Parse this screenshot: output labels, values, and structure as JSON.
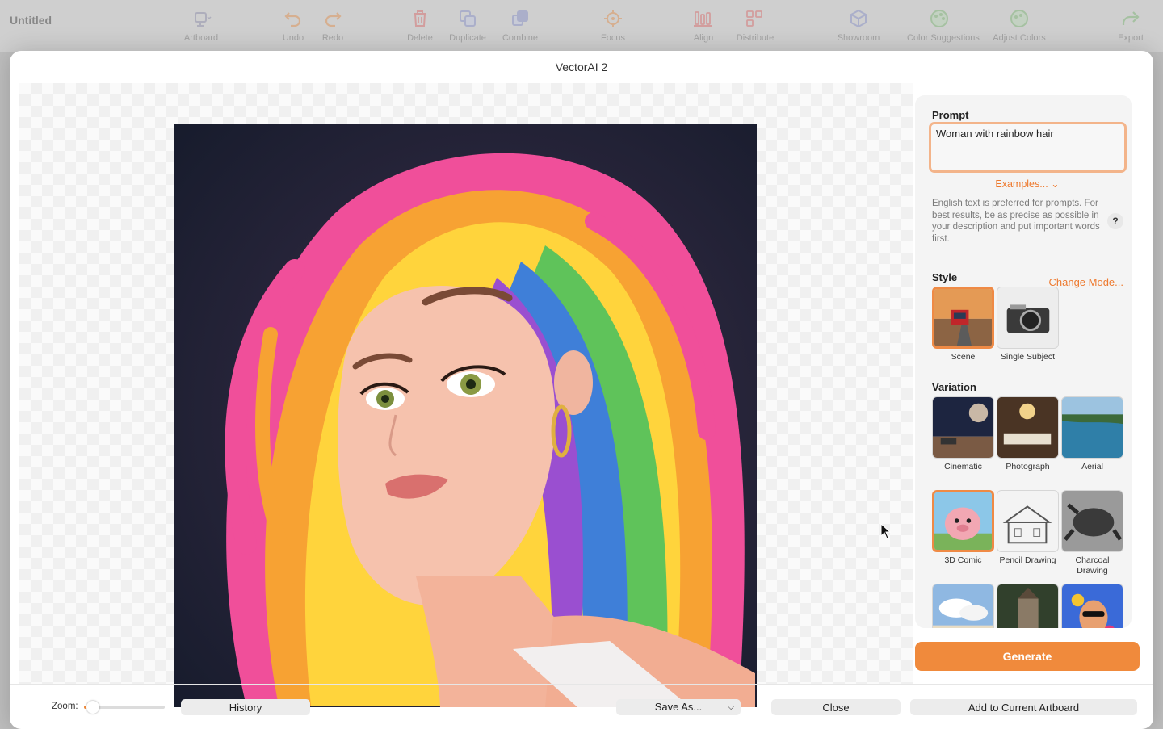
{
  "app": {
    "title": "Untitled",
    "toolbar": [
      {
        "id": "artboard",
        "label": "Artboard",
        "icon": "artboard-icon"
      },
      {
        "id": "undo",
        "label": "Undo",
        "icon": "undo-icon"
      },
      {
        "id": "redo",
        "label": "Redo",
        "icon": "redo-icon"
      },
      {
        "id": "delete",
        "label": "Delete",
        "icon": "trash-icon"
      },
      {
        "id": "duplicate",
        "label": "Duplicate",
        "icon": "duplicate-icon"
      },
      {
        "id": "combine",
        "label": "Combine",
        "icon": "combine-icon"
      },
      {
        "id": "focus",
        "label": "Focus",
        "icon": "focus-icon"
      },
      {
        "id": "align",
        "label": "Align",
        "icon": "align-icon"
      },
      {
        "id": "distribute",
        "label": "Distribute",
        "icon": "distribute-icon"
      },
      {
        "id": "showroom",
        "label": "Showroom",
        "icon": "cube-icon"
      },
      {
        "id": "color_suggestions",
        "label": "Color Suggestions",
        "icon": "palette-icon"
      },
      {
        "id": "adjust_colors",
        "label": "Adjust Colors",
        "icon": "palette-adjust-icon"
      },
      {
        "id": "export",
        "label": "Export",
        "icon": "share-arrow-icon"
      }
    ]
  },
  "modal": {
    "title": "VectorAI 2",
    "prompt": {
      "label": "Prompt",
      "value": "Woman with rainbow hair",
      "examples_label": "Examples... ⌄",
      "hint": "English text is preferred for prompts. For best results, be as precise as possible in your description and put important words first.",
      "help": "?"
    },
    "style": {
      "label": "Style",
      "change_mode": "Change Mode...",
      "options": [
        {
          "label": "Scene",
          "selected": true
        },
        {
          "label": "Single Subject",
          "selected": false
        }
      ]
    },
    "variation": {
      "label": "Variation",
      "options": [
        {
          "label": "Cinematic",
          "selected": false
        },
        {
          "label": "Photograph",
          "selected": false
        },
        {
          "label": "Aerial",
          "selected": false
        },
        {
          "label": "3D Comic",
          "selected": true
        },
        {
          "label": "Pencil Drawing",
          "selected": false
        },
        {
          "label": "Charcoal Drawing",
          "selected": false
        },
        {
          "label": "",
          "selected": false
        },
        {
          "label": "",
          "selected": false
        },
        {
          "label": "",
          "selected": false
        }
      ]
    },
    "generate_label": "Generate",
    "footer": {
      "zoom_label": "Zoom:",
      "zoom_value": 0.05,
      "history_label": "History",
      "save_as_label": "Save As...",
      "close_label": "Close",
      "add_label": "Add to Current Artboard"
    },
    "colors": {
      "accent": "#f08a3c",
      "accent_text": "#ee7a2f",
      "prompt_border": "#f3b48a"
    }
  }
}
